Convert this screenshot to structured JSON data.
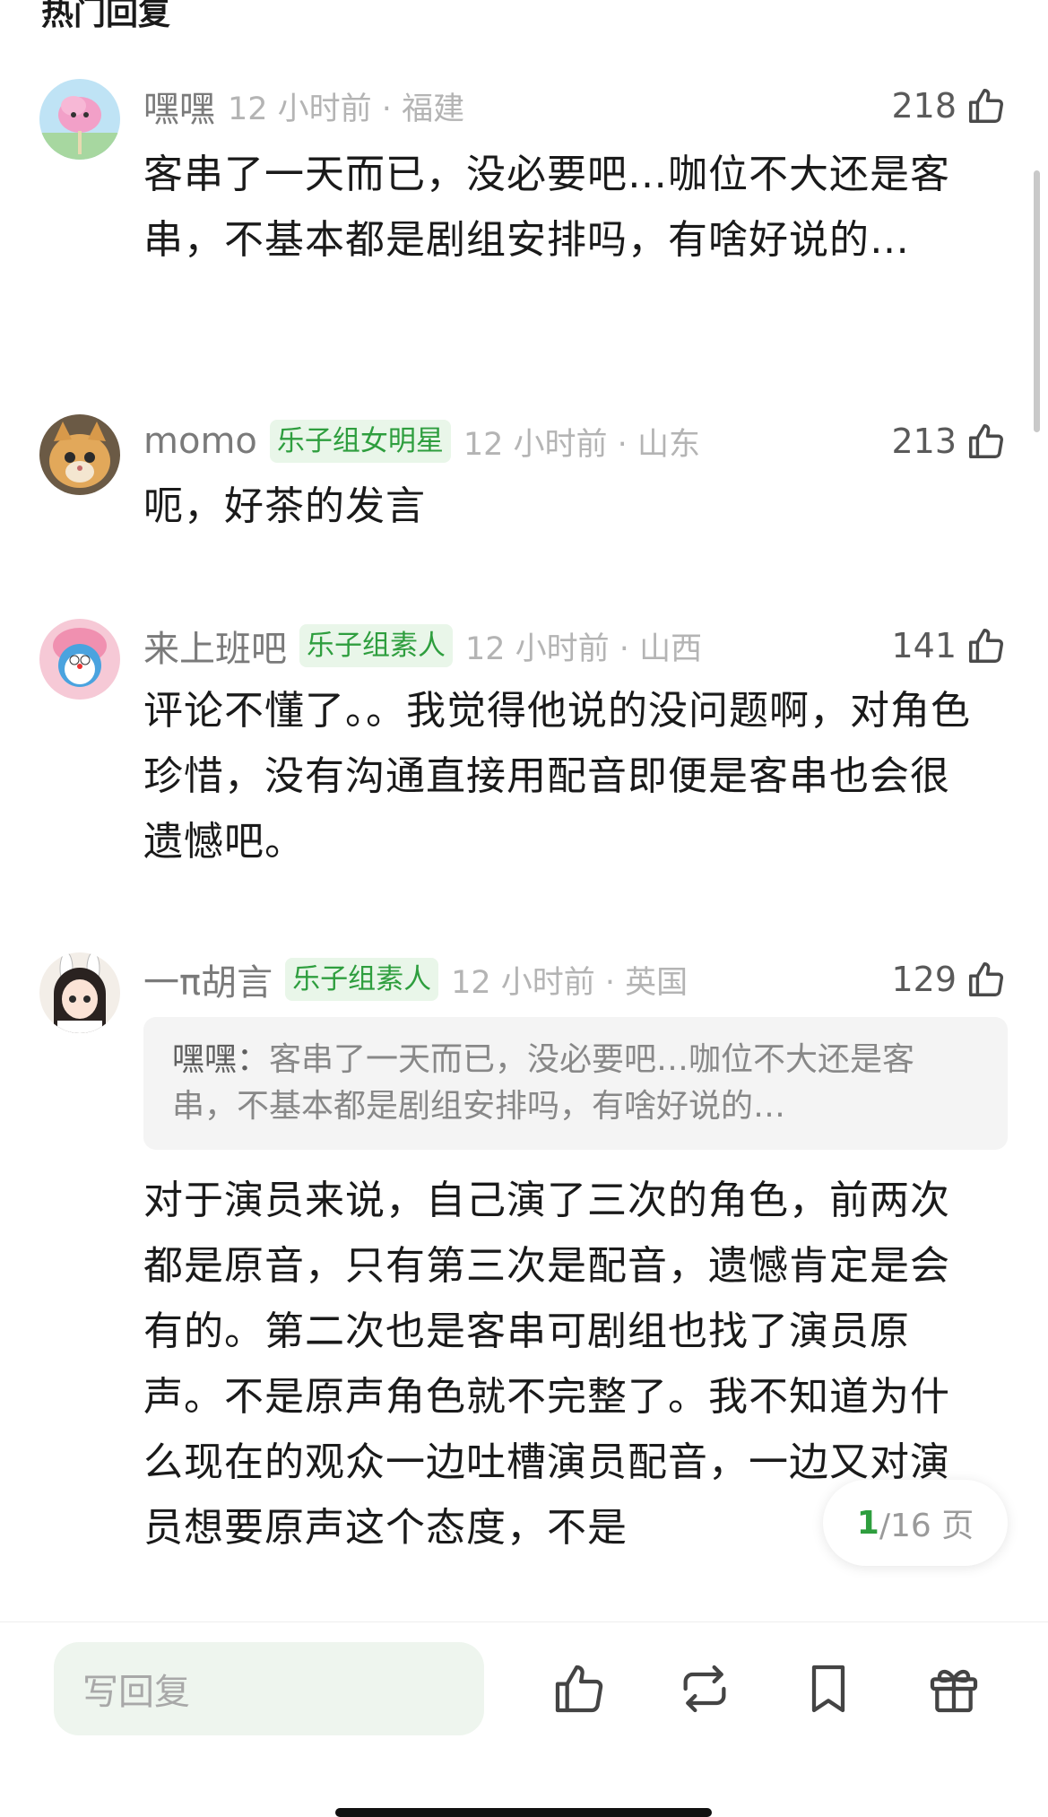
{
  "section_title": "热门回复",
  "comments": [
    {
      "username": "嘿嘿",
      "badge": "",
      "time": "12 小时前",
      "location": "福建",
      "likes": "218",
      "text": "客串了一天而已，没必要吧…咖位不大还是客串，不基本都是剧组安排吗，有啥好说的…"
    },
    {
      "username": "momo",
      "badge": "乐子组女明星",
      "time": "12 小时前",
      "location": "山东",
      "likes": "213",
      "text": "呃，好茶的发言"
    },
    {
      "username": "来上班吧",
      "badge": "乐子组素人",
      "time": "12 小时前",
      "location": "山西",
      "likes": "141",
      "text": "评论不懂了。。我觉得他说的没问题啊，对角色珍惜，没有沟通直接用配音即便是客串也会很遗憾吧。"
    },
    {
      "username": "一π胡言",
      "badge": "乐子组素人",
      "time": "12 小时前",
      "location": "英国",
      "likes": "129",
      "quote_author": "嘿嘿：",
      "quote_text": "客串了一天而已，没必要吧…咖位不大还是客串，不基本都是剧组安排吗，有啥好说的…",
      "text": "对于演员来说，自己演了三次的角色，前两次都是原音，只有第三次是配音，遗憾肯定是会有的。第二次也是客串可剧组也找了演员原声。不是原声角色就不完整了。我不知道为什么现在的观众一边吐槽演员配音，一边又对演员想要原声这个态度，不是"
    }
  ],
  "pager": {
    "current": "1",
    "total": "/16 页"
  },
  "bottom_bar": {
    "reply_placeholder": "写回复",
    "icons": [
      "thumbs-up-icon",
      "repost-icon",
      "bookmark-icon",
      "gift-icon"
    ]
  },
  "colors": {
    "accent_green": "#2e9e3e",
    "badge_bg": "#e9f6e9",
    "input_bg": "#eef5ee"
  }
}
